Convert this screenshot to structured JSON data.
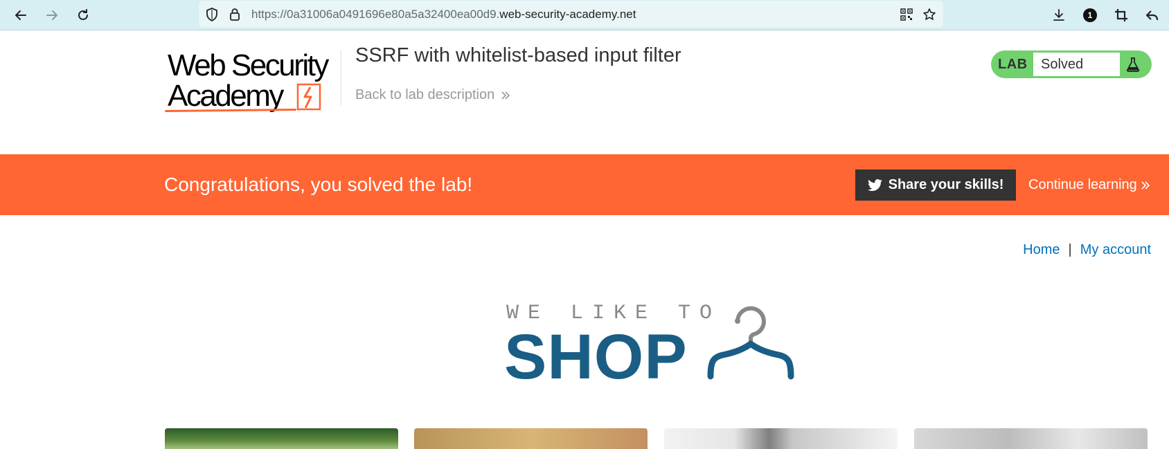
{
  "browser": {
    "url_prefix": "https://0a31006a0491696e80a5a32400ea00d9.",
    "url_domain": "web-security-academy.net",
    "extension_badge": "1"
  },
  "header": {
    "logo_line1": "Web Security",
    "logo_line2": "Academy",
    "lab_title": "SSRF with whitelist-based input filter",
    "back_link": "Back to lab description",
    "lab_tag": "LAB",
    "lab_status": "Solved"
  },
  "banner": {
    "message": "Congratulations, you solved the lab!",
    "share_label": "Share your skills!",
    "continue_label": "Continue learning"
  },
  "nav": {
    "home": "Home",
    "separator": "|",
    "account": "My account"
  },
  "shop_banner": {
    "tagline": "WE LIKE TO",
    "word": "SHOP"
  },
  "colors": {
    "accent": "#ff6633",
    "lab_green": "#70d16d",
    "link_blue": "#0071bc",
    "shop_blue": "#1a5e85"
  },
  "products": [
    {
      "image": "green-foliage"
    },
    {
      "image": "tan-product"
    },
    {
      "image": "person-portrait"
    },
    {
      "image": "grey-product"
    }
  ]
}
